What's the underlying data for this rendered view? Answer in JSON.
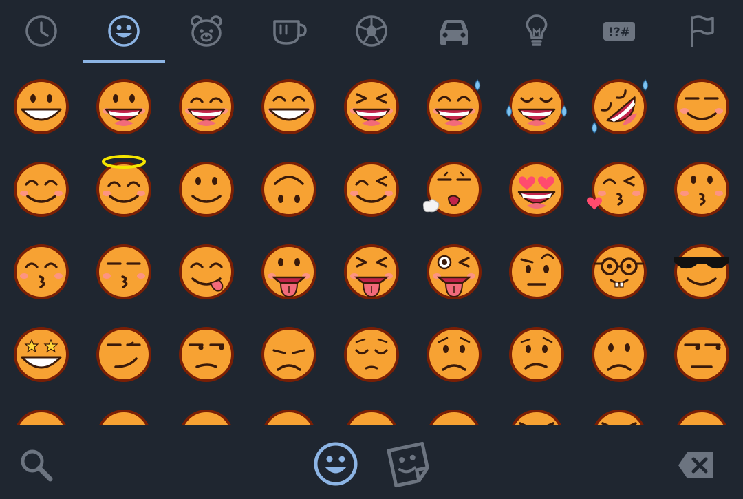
{
  "panel": {
    "colors": {
      "background": "#1f2630",
      "icon": "#6c7480",
      "active": "#8cb4e4",
      "emoji_fill": "#f7a233",
      "emoji_outline": "#7a1f05"
    },
    "category_tabs": [
      {
        "id": "recent",
        "icon": "clock-icon",
        "active": false
      },
      {
        "id": "smileys",
        "icon": "smiley-icon",
        "active": true
      },
      {
        "id": "animals",
        "icon": "bear-icon",
        "active": false
      },
      {
        "id": "food",
        "icon": "cup-icon",
        "active": false
      },
      {
        "id": "activity",
        "icon": "soccer-ball-icon",
        "active": false
      },
      {
        "id": "travel",
        "icon": "car-icon",
        "active": false
      },
      {
        "id": "objects",
        "icon": "lightbulb-icon",
        "active": false
      },
      {
        "id": "symbols",
        "icon": "symbols-icon",
        "active": false,
        "label": "!?#"
      },
      {
        "id": "flags",
        "icon": "flag-icon",
        "active": false
      }
    ]
  },
  "emoji_rows": [
    [
      "grinning-face",
      "grinning-face-big-eyes",
      "grinning-face-smiling-eyes",
      "beaming-face",
      "grinning-squinting-face",
      "grinning-face-sweat",
      "face-tears-of-joy",
      "rolling-on-floor-laughing",
      "smiling-face-smiling-eyes"
    ],
    [
      "smiling-face-blush",
      "smiling-face-halo",
      "slightly-smiling-face",
      "upside-down-face",
      "winking-face",
      "sleepy-exhaling-face",
      "smiling-face-heart-eyes",
      "face-blowing-kiss",
      "kissing-face"
    ],
    [
      "kissing-face-smiling-eyes",
      "kissing-face-closed-eyes",
      "face-savoring-food",
      "face-with-tongue",
      "squinting-face-tongue",
      "zany-face",
      "face-raised-eyebrow",
      "nerd-face",
      "smiling-face-sunglasses"
    ],
    [
      "star-struck",
      "smirking-face",
      "unamused-face",
      "disappointed-face",
      "pensive-face",
      "worried-face",
      "confused-face",
      "slightly-frowning-face",
      "expressionless-side-eye"
    ],
    [
      "persevering-face",
      "confounded-face",
      "tired-face",
      "weary-face",
      "pleading-face",
      "crying-face",
      "angry-face",
      "pouting-face",
      "exploding-head"
    ]
  ],
  "bottom_bar": {
    "search": {
      "icon": "search-icon"
    },
    "emoji_mode": {
      "icon": "smiley-icon",
      "active": true
    },
    "sticker_mode": {
      "icon": "sticker-icon",
      "active": false
    },
    "backspace": {
      "icon": "backspace-icon"
    }
  }
}
